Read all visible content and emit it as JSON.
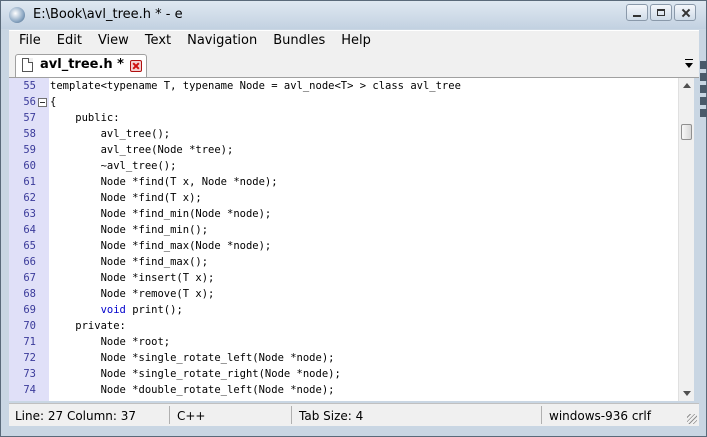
{
  "window": {
    "title": "E:\\Book\\avl_tree.h * - e",
    "buttons": {
      "minimize": "minimize",
      "maximize": "maximize",
      "close": "close"
    }
  },
  "menu": [
    "File",
    "Edit",
    "View",
    "Text",
    "Navigation",
    "Bundles",
    "Help"
  ],
  "tabs": [
    {
      "label": "avl_tree.h *",
      "active": true
    }
  ],
  "editor": {
    "lines": [
      {
        "n": "55",
        "code": "template<typename T, typename Node = avl_node<T> > class avl_tree"
      },
      {
        "n": "56",
        "code": "{",
        "fold": true
      },
      {
        "n": "57",
        "code": "    public:"
      },
      {
        "n": "58",
        "code": "        avl_tree();"
      },
      {
        "n": "59",
        "code": "        avl_tree(Node *tree);"
      },
      {
        "n": "60",
        "code": "        ~avl_tree();"
      },
      {
        "n": "61",
        "code": "        Node *find(T x, Node *node);"
      },
      {
        "n": "62",
        "code": "        Node *find(T x);"
      },
      {
        "n": "63",
        "code": "        Node *find_min(Node *node);"
      },
      {
        "n": "64",
        "code": "        Node *find_min();"
      },
      {
        "n": "65",
        "code": "        Node *find_max(Node *node);"
      },
      {
        "n": "66",
        "code": "        Node *find_max();"
      },
      {
        "n": "67",
        "code": "        Node *insert(T x);"
      },
      {
        "n": "68",
        "code": "        Node *remove(T x);"
      },
      {
        "n": "69",
        "code": "        void print();",
        "keyword": "void"
      },
      {
        "n": "70",
        "code": "    private:"
      },
      {
        "n": "71",
        "code": "        Node *root;"
      },
      {
        "n": "72",
        "code": "        Node *single_rotate_left(Node *node);"
      },
      {
        "n": "73",
        "code": "        Node *single_rotate_right(Node *node);"
      },
      {
        "n": "74",
        "code": "        Node *double_rotate_left(Node *node);"
      }
    ],
    "keyword_color": "#0000cc",
    "gutter_color": "#e0e0f8"
  },
  "status": {
    "position": "Line: 27  Column: 37",
    "language": "C++",
    "tab_size": "Tab Size: 4",
    "encoding": "windows-936 crlf"
  }
}
